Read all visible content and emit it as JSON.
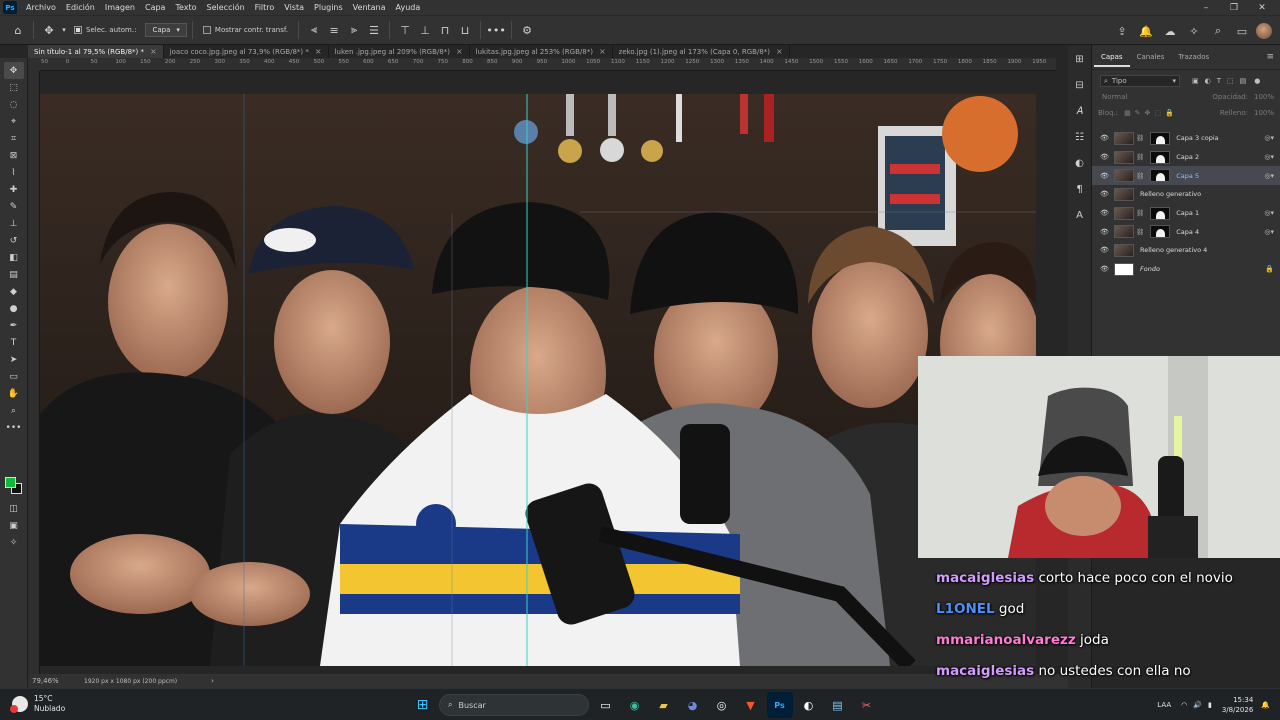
{
  "menubar": {
    "logo": "Ps",
    "items": [
      "Archivo",
      "Edición",
      "Imagen",
      "Capa",
      "Texto",
      "Selección",
      "Filtro",
      "Vista",
      "Plugins",
      "Ventana",
      "Ayuda"
    ]
  },
  "options": {
    "auto_select_label": "Selec. autom.:",
    "auto_select_value": "Capa",
    "transform_label": "Mostrar contr. transf."
  },
  "tabs": [
    {
      "label": "Sin título-1 al 79,5% (RGB/8*) *",
      "active": true
    },
    {
      "label": "joaco coco.jpg.jpeg al 73,9% (RGB/8*) *",
      "active": false
    },
    {
      "label": "luken .jpg.jpeg al 209% (RGB/8*)",
      "active": false
    },
    {
      "label": "lukitas.jpg.jpeg al 253% (RGB/8*)",
      "active": false
    },
    {
      "label": "zeko.jpg (1).jpeg al 173% (Capa 0, RGB/8*)",
      "active": false
    }
  ],
  "ruler": {
    "marks": [
      "50",
      "0",
      "50",
      "100",
      "150",
      "200",
      "250",
      "300",
      "350",
      "400",
      "450",
      "500",
      "550",
      "600",
      "650",
      "700",
      "750",
      "800",
      "850",
      "900",
      "950",
      "1000",
      "1050",
      "1100",
      "1150",
      "1200",
      "1250",
      "1300",
      "1350",
      "1400",
      "1450",
      "1500",
      "1550",
      "1600",
      "1650",
      "1700",
      "1750",
      "1800",
      "1850",
      "1900",
      "1950"
    ]
  },
  "status": {
    "zoom": "79,46%",
    "doc_info": "1920 px x 1080 px (200 ppcm)"
  },
  "layers_panel": {
    "tabs": [
      "Capas",
      "Canales",
      "Trazados"
    ],
    "filter": "Tipo",
    "blend_mode": "Normal",
    "opacity_label": "Opacidad:",
    "opacity_value": "100%",
    "lock_label": "Bloq.:",
    "fill_label": "Relleno:",
    "fill_value": "100%",
    "layers": [
      {
        "name": "Capa 3 copia",
        "mask": true,
        "selected": false
      },
      {
        "name": "Capa 2",
        "mask": true,
        "selected": false
      },
      {
        "name": "Capa 5",
        "mask": true,
        "selected": true
      },
      {
        "name": "Relleno generativo",
        "mask": false,
        "selected": false
      },
      {
        "name": "Capa 1",
        "mask": true,
        "selected": false
      },
      {
        "name": "Capa 4",
        "mask": true,
        "selected": false
      },
      {
        "name": "Relleno generativo 4",
        "mask": false,
        "selected": false
      },
      {
        "name": "Fondo",
        "mask": false,
        "selected": false
      }
    ]
  },
  "chat": [
    {
      "user": "macaiglesias",
      "color": "#d39cff",
      "message": "corto hace poco con el novio"
    },
    {
      "user": "L1ONEL",
      "color": "#4f8ff7",
      "message": "god"
    },
    {
      "user": "mmarianoalvarezz",
      "color": "#ff7bd6",
      "message": "joda"
    },
    {
      "user": "macaiglesias",
      "color": "#d39cff",
      "message": "no ustedes con ella no"
    }
  ],
  "taskbar": {
    "temperature": "15°C",
    "weather": "Nublado",
    "search_placeholder": "Buscar",
    "lang": "LAA",
    "time": "15:34",
    "date": "3/8/2026"
  },
  "colors": {
    "foreground": "#11b83a",
    "background": "#111111",
    "guide": "#38d0c7"
  }
}
